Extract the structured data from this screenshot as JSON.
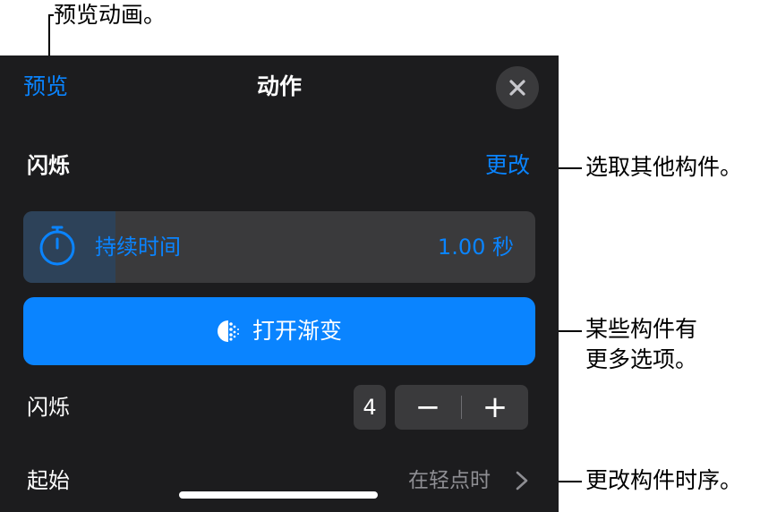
{
  "callouts": {
    "preview": "预览动画。",
    "choose": "选取其他构件。",
    "more_options_line1": "某些构件有",
    "more_options_line2": "更多选项。",
    "timing": "更改构件时序。"
  },
  "header": {
    "preview_label": "预览",
    "title": "动作"
  },
  "action": {
    "name": "闪烁",
    "change_label": "更改"
  },
  "duration": {
    "label": "持续时间",
    "value": "1.00 秒",
    "fill_fraction": 0.18
  },
  "fade_button": {
    "label": "打开渐变"
  },
  "blink": {
    "label": "闪烁",
    "count": "4",
    "minus": "−",
    "plus": "+"
  },
  "start": {
    "label": "起始",
    "value": "在轻点时"
  },
  "colors": {
    "accent": "#0a84ff",
    "panel": "#1c1c1e",
    "control": "#3a3a3c"
  }
}
